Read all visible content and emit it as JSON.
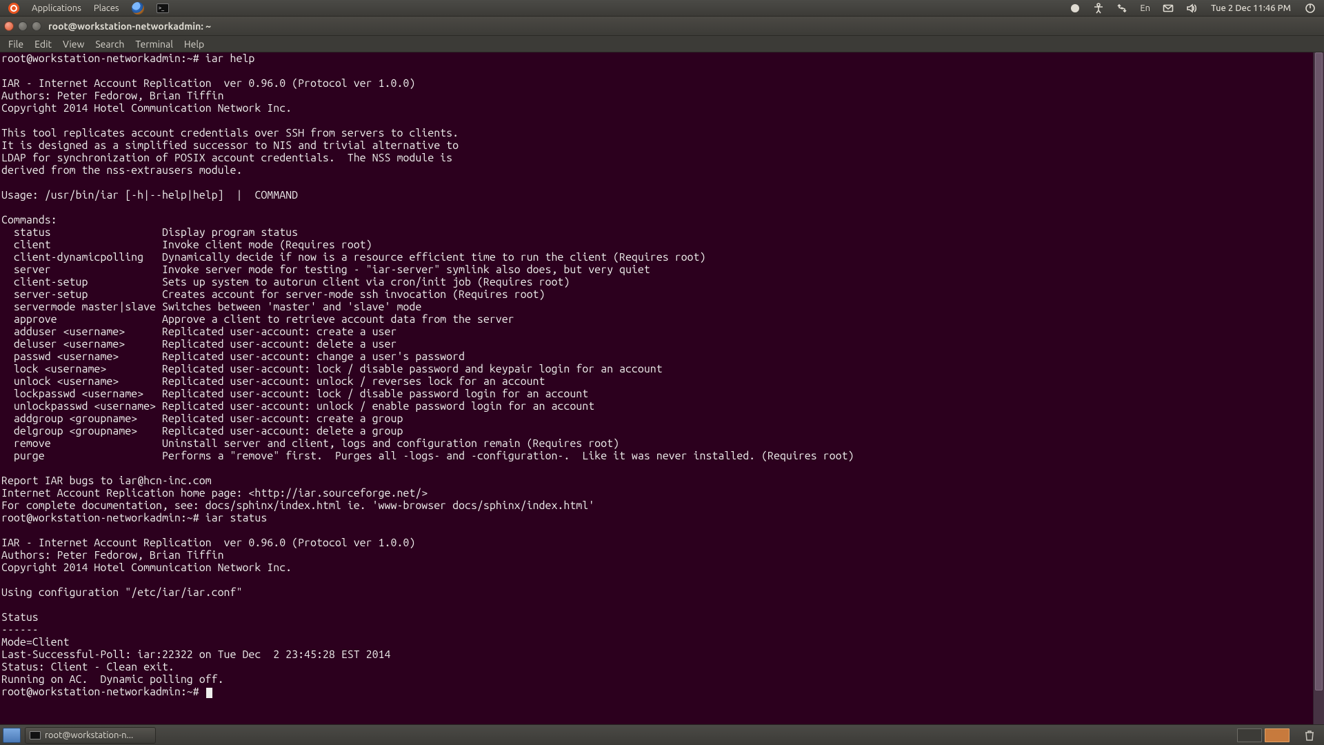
{
  "panel": {
    "applications": "Applications",
    "places": "Places",
    "lang": "En",
    "clock": "Tue  2 Dec 11:46 PM"
  },
  "window": {
    "title": "root@workstation-networkadmin: ~"
  },
  "menubar": {
    "file": "File",
    "edit": "Edit",
    "view": "View",
    "search": "Search",
    "terminal": "Terminal",
    "help": "Help"
  },
  "taskbar": {
    "task1": "root@workstation-n..."
  },
  "terminal": {
    "raw": "root@workstation-networkadmin:~# iar help\n\nIAR - Internet Account Replication  ver 0.96.0 (Protocol ver 1.0.0)\nAuthors: Peter Fedorow, Brian Tiffin\nCopyright 2014 Hotel Communication Network Inc.\n\nThis tool replicates account credentials over SSH from servers to clients.\nIt is designed as a simplified successor to NIS and trivial alternative to\nLDAP for synchronization of POSIX account credentials.  The NSS module is\nderived from the nss-extrausers module.\n\nUsage: /usr/bin/iar [-h|--help|help]  |  COMMAND\n\nCommands:\n  status                  Display program status\n  client                  Invoke client mode (Requires root)\n  client-dynamicpolling   Dynamically decide if now is a resource efficient time to run the client (Requires root)\n  server                  Invoke server mode for testing - \"iar-server\" symlink also does, but very quiet\n  client-setup            Sets up system to autorun client via cron/init job (Requires root)\n  server-setup            Creates account for server-mode ssh invocation (Requires root)\n  servermode master|slave Switches between 'master' and 'slave' mode\n  approve                 Approve a client to retrieve account data from the server\n  adduser <username>      Replicated user-account: create a user\n  deluser <username>      Replicated user-account: delete a user\n  passwd <username>       Replicated user-account: change a user's password\n  lock <username>         Replicated user-account: lock / disable password and keypair login for an account\n  unlock <username>       Replicated user-account: unlock / reverses lock for an account\n  lockpasswd <username>   Replicated user-account: lock / disable password login for an account\n  unlockpasswd <username> Replicated user-account: unlock / enable password login for an account\n  addgroup <groupname>    Replicated user-account: create a group\n  delgroup <groupname>    Replicated user-account: delete a group\n  remove                  Uninstall server and client, logs and configuration remain (Requires root)\n  purge                   Performs a \"remove\" first.  Purges all -logs- and -configuration-.  Like it was never installed. (Requires root)\n\nReport IAR bugs to iar@hcn-inc.com\nInternet Account Replication home page: <http://iar.sourceforge.net/>\nFor complete documentation, see: docs/sphinx/index.html ie. 'www-browser docs/sphinx/index.html'\nroot@workstation-networkadmin:~# iar status\n\nIAR - Internet Account Replication  ver 0.96.0 (Protocol ver 1.0.0)\nAuthors: Peter Fedorow, Brian Tiffin\nCopyright 2014 Hotel Communication Network Inc.\n\nUsing configuration \"/etc/iar/iar.conf\"\n\nStatus\n------\nMode=Client\nLast-Successful-Poll: iar:22322 on Tue Dec  2 23:45:28 EST 2014\nStatus: Client - Clean exit.\nRunning on AC.  Dynamic polling off.\nroot@workstation-networkadmin:~# "
  }
}
